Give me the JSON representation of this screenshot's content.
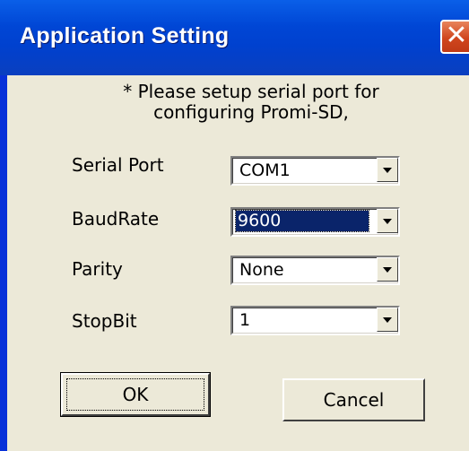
{
  "window": {
    "title": "Application Setting",
    "close_glyph": "✕"
  },
  "instruction": {
    "line1": "* Please setup serial port for",
    "line2": "configuring Promi-SD,"
  },
  "fields": [
    {
      "label": "Serial Port",
      "value": "COM1"
    },
    {
      "label": "BaudRate",
      "value": "9600"
    },
    {
      "label": "Parity",
      "value": "None"
    },
    {
      "label": "StopBit",
      "value": "1"
    }
  ],
  "buttons": {
    "ok": "OK",
    "cancel": "Cancel"
  },
  "colors": {
    "titlebar": "#0046d5",
    "dialog_bg": "#ece9d8",
    "selection": "#0a246a"
  }
}
